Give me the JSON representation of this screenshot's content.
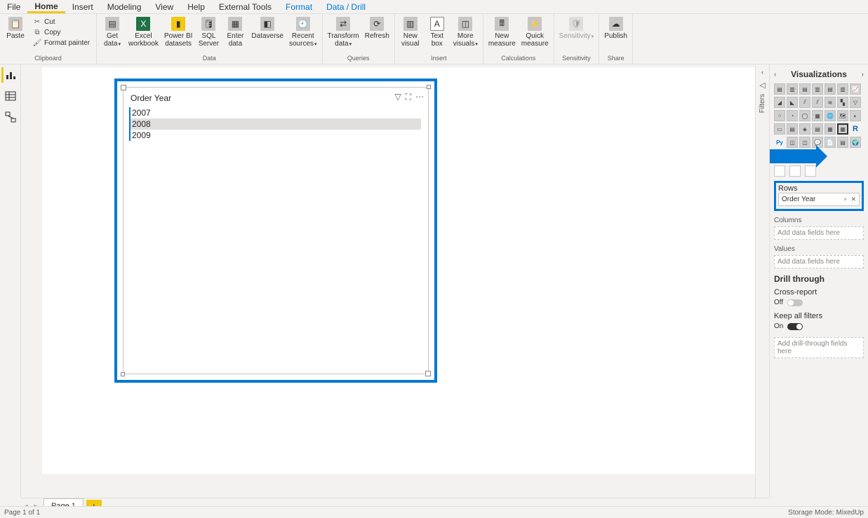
{
  "tabs": [
    "File",
    "Home",
    "Insert",
    "Modeling",
    "View",
    "Help",
    "External Tools",
    "Format",
    "Data / Drill"
  ],
  "active_tab": "Home",
  "highlighted_tabs": [
    "Format",
    "Data / Drill"
  ],
  "ribbon": {
    "clipboard": {
      "label": "Clipboard",
      "paste": "Paste",
      "cut": "Cut",
      "copy": "Copy",
      "format_painter": "Format painter"
    },
    "data": {
      "label": "Data",
      "get_data": "Get\ndata",
      "excel": "Excel\nworkbook",
      "powerbi": "Power BI\ndatasets",
      "sql": "SQL\nServer",
      "enter": "Enter\ndata",
      "dataverse": "Dataverse",
      "recent": "Recent\nsources"
    },
    "queries": {
      "label": "Queries",
      "transform": "Transform\ndata",
      "refresh": "Refresh"
    },
    "insert": {
      "label": "Insert",
      "new_visual": "New\nvisual",
      "text_box": "Text\nbox",
      "more_visuals": "More\nvisuals"
    },
    "calculations": {
      "label": "Calculations",
      "new_measure": "New\nmeasure",
      "quick_measure": "Quick\nmeasure"
    },
    "sensitivity": {
      "label": "Sensitivity",
      "sensitivity": "Sensitivity"
    },
    "share": {
      "label": "Share",
      "publish": "Publish"
    }
  },
  "visual": {
    "title": "Order Year",
    "rows": [
      "2007",
      "2008",
      "2009"
    ],
    "selected_row": "2008"
  },
  "filters_label": "Filters",
  "viz_pane": {
    "title": "Visualizations",
    "rows": "Rows",
    "rows_field": "Order Year",
    "columns": "Columns",
    "values": "Values",
    "placeholder": "Add data fields here",
    "drill": "Drill through",
    "cross": "Cross-report",
    "off": "Off",
    "keep": "Keep all filters",
    "on": "On",
    "drill_placeholder": "Add drill-through fields here"
  },
  "page_tab": "Page 1",
  "status_left": "Page 1 of 1",
  "status_right": "Storage Mode: MixedUp"
}
